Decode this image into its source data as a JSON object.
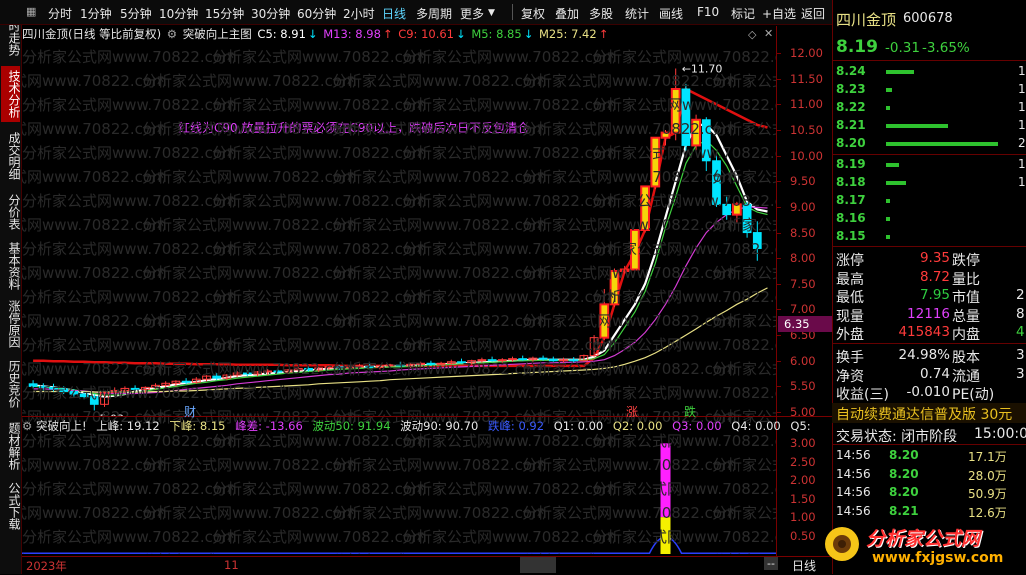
{
  "toolbar": {
    "periods": [
      "分时",
      "1分钟",
      "5分钟",
      "10分钟",
      "15分钟",
      "30分钟",
      "60分钟",
      "2小时",
      "日线",
      "多周期",
      "更多"
    ],
    "active_period": "日线",
    "actions": [
      "复权",
      "叠加",
      "多股",
      "统计",
      "画线",
      "F10",
      "标记",
      "+自选",
      "返回"
    ]
  },
  "left_tabs": [
    "分时走势",
    "技术分析",
    "成交明细",
    "分价表",
    "基本资料",
    "涨停原因",
    "历史竞价",
    "题材解析",
    "公式下载"
  ],
  "chart_header": {
    "title": "四川金顶(日线 等比前复权)",
    "formula": "突破向上主图",
    "c5": "C5: 8.91",
    "m13": "M13: 8.98",
    "c9": "C9: 10.61",
    "m5": "M5: 8.85",
    "m25": "M25: 7.42"
  },
  "annotation": "红线为C90,放量拉升的票必须在C90以上，跌破后次日不反包清仓",
  "watermark": "分析家公式网www.70822.com",
  "price_axis": [
    "12.00",
    "11.50",
    "11.00",
    "10.50",
    "10.00",
    "9.50",
    "9.00",
    "8.50",
    "8.00",
    "7.50",
    "7.00",
    "6.50",
    "6.00",
    "5.50",
    "5.00"
  ],
  "current_price_tag": "6.35",
  "high_label": "11.70",
  "low_label": "5.03",
  "markers": {
    "cai": "财",
    "zhang": "涨",
    "die": "跌"
  },
  "indicator_header": {
    "name": "突破向上!",
    "shang_feng": "上峰: 19.12",
    "xia_feng": "下峰: 8.15",
    "feng_cha": "峰差: -13.66",
    "bo50": "波动50: 91.94",
    "bo90": "波动90: 90.70",
    "die_feng": "跌峰: 0.92",
    "q1": "Q1: 0.00",
    "q2": "Q2: 0.00",
    "q3": "Q3: 0.00",
    "q4": "Q4: 0.00",
    "q5": "Q5:"
  },
  "indicator_axis": [
    "3.00",
    "2.50",
    "2.00",
    "1.50",
    "1.00",
    "0.50"
  ],
  "date_axis": {
    "y2023": "2023年",
    "m11": "11",
    "m12": "12",
    "period": "日线",
    "dash": "--"
  },
  "stock": {
    "name": "四川金顶",
    "code": "600678",
    "price": "8.19",
    "change": "-0.31",
    "pct": "-3.65%"
  },
  "order_book": [
    {
      "price": "8.24",
      "vol": "1",
      "bar": 0.25
    },
    {
      "price": "8.23",
      "vol": "1",
      "bar": 0.05
    },
    {
      "price": "8.22",
      "vol": "1",
      "bar": 0.04
    },
    {
      "price": "8.21",
      "vol": "10",
      "bar": 0.55
    },
    {
      "price": "8.20",
      "vol": "20",
      "bar": 1.0
    },
    {
      "price": "8.19",
      "vol": "1",
      "bar": 0.12
    },
    {
      "price": "8.18",
      "vol": "1",
      "bar": 0.18
    },
    {
      "price": "8.17",
      "vol": "",
      "bar": 0.03
    },
    {
      "price": "8.16",
      "vol": "",
      "bar": 0.03
    },
    {
      "price": "8.15",
      "vol": "",
      "bar": 0.03
    }
  ],
  "quote": [
    {
      "l": "涨停",
      "v": "9.35",
      "c": "#ff3b3b",
      "l2": "跌停",
      "v2": ""
    },
    {
      "l": "最高",
      "v": "8.72",
      "c": "#ff3b3b",
      "l2": "量比",
      "v2": ""
    },
    {
      "l": "最低",
      "v": "7.95",
      "c": "#2ecc40",
      "l2": "市值",
      "v2": "2"
    },
    {
      "l": "现量",
      "v": "12116",
      "c": "#e040fb",
      "l2": "总量",
      "v2": "8"
    },
    {
      "l": "外盘",
      "v": "415843",
      "c": "#ff3b3b",
      "l2": "内盘",
      "v2": "4"
    },
    {
      "l": "换手",
      "v": "24.98%",
      "c": "#e8e8e8",
      "l2": "股本",
      "v2": "3"
    },
    {
      "l": "净资",
      "v": "0.74",
      "c": "#e8e8e8",
      "l2": "流通",
      "v2": "3"
    },
    {
      "l": "收益(三)",
      "v": "-0.010",
      "c": "#e8e8e8",
      "l2": "PE(动)",
      "v2": ""
    }
  ],
  "promo": "自动续费通达信普及版 30元",
  "trade_status": {
    "label": "交易状态: 闭市阶段",
    "time": "15:00:02"
  },
  "ticks": [
    {
      "t": "14:56",
      "p": "8.20",
      "v": "17.1万"
    },
    {
      "t": "14:56",
      "p": "8.20",
      "v": "28.0万"
    },
    {
      "t": "14:56",
      "p": "8.20",
      "v": "50.9万"
    },
    {
      "t": "14:56",
      "p": "8.21",
      "v": "12.6万"
    }
  ],
  "logo": {
    "cn": "分析家公式网",
    "url": "www.fxjgsw.com"
  },
  "colors": {
    "up": "#ff3b3b",
    "down": "#00e5ff",
    "c90": "#e01010",
    "ma_white": "#ffffff",
    "ma_green": "#3ed13e",
    "ma_magenta": "#d33bd3",
    "ma_yellow": "#e8e085"
  },
  "chart_data": {
    "type": "candlestick",
    "price_range": [
      5.0,
      12.1
    ],
    "candles": [
      {
        "o": 5.55,
        "h": 5.62,
        "l": 5.45,
        "c": 5.5
      },
      {
        "o": 5.5,
        "h": 5.56,
        "l": 5.42,
        "c": 5.48
      },
      {
        "o": 5.48,
        "h": 5.55,
        "l": 5.4,
        "c": 5.45
      },
      {
        "o": 5.45,
        "h": 5.5,
        "l": 5.35,
        "c": 5.4
      },
      {
        "o": 5.4,
        "h": 5.45,
        "l": 5.3,
        "c": 5.35
      },
      {
        "o": 5.35,
        "h": 5.4,
        "l": 5.25,
        "c": 5.3
      },
      {
        "o": 5.3,
        "h": 5.35,
        "l": 5.03,
        "c": 5.15
      },
      {
        "o": 5.15,
        "h": 5.4,
        "l": 5.1,
        "c": 5.38
      },
      {
        "o": 5.38,
        "h": 5.48,
        "l": 5.33,
        "c": 5.42
      },
      {
        "o": 5.42,
        "h": 5.5,
        "l": 5.38,
        "c": 5.46
      },
      {
        "o": 5.46,
        "h": 5.52,
        "l": 5.4,
        "c": 5.44
      },
      {
        "o": 5.44,
        "h": 5.5,
        "l": 5.38,
        "c": 5.48
      },
      {
        "o": 5.48,
        "h": 5.56,
        "l": 5.44,
        "c": 5.52
      },
      {
        "o": 5.52,
        "h": 5.6,
        "l": 5.48,
        "c": 5.56
      },
      {
        "o": 5.56,
        "h": 5.62,
        "l": 5.5,
        "c": 5.6
      },
      {
        "o": 5.6,
        "h": 5.66,
        "l": 5.54,
        "c": 5.58
      },
      {
        "o": 5.58,
        "h": 5.68,
        "l": 5.55,
        "c": 5.64
      },
      {
        "o": 5.64,
        "h": 5.72,
        "l": 5.6,
        "c": 5.7
      },
      {
        "o": 5.7,
        "h": 5.76,
        "l": 5.62,
        "c": 5.66
      },
      {
        "o": 5.66,
        "h": 5.74,
        "l": 5.62,
        "c": 5.72
      },
      {
        "o": 5.72,
        "h": 5.8,
        "l": 5.68,
        "c": 5.76
      },
      {
        "o": 5.76,
        "h": 5.82,
        "l": 5.7,
        "c": 5.74
      },
      {
        "o": 5.74,
        "h": 5.8,
        "l": 5.7,
        "c": 5.78
      },
      {
        "o": 5.78,
        "h": 5.84,
        "l": 5.72,
        "c": 5.8
      },
      {
        "o": 5.8,
        "h": 5.86,
        "l": 5.75,
        "c": 5.78
      },
      {
        "o": 5.78,
        "h": 5.84,
        "l": 5.74,
        "c": 5.82
      },
      {
        "o": 5.82,
        "h": 5.88,
        "l": 5.78,
        "c": 5.85
      },
      {
        "o": 5.85,
        "h": 5.9,
        "l": 5.79,
        "c": 5.82
      },
      {
        "o": 5.82,
        "h": 5.88,
        "l": 5.78,
        "c": 5.86
      },
      {
        "o": 5.86,
        "h": 5.92,
        "l": 5.82,
        "c": 5.88
      },
      {
        "o": 5.88,
        "h": 5.92,
        "l": 5.82,
        "c": 5.86
      },
      {
        "o": 5.86,
        "h": 5.9,
        "l": 5.82,
        "c": 5.88
      },
      {
        "o": 5.88,
        "h": 5.94,
        "l": 5.84,
        "c": 5.9
      },
      {
        "o": 5.9,
        "h": 5.96,
        "l": 5.85,
        "c": 5.87
      },
      {
        "o": 5.87,
        "h": 5.92,
        "l": 5.83,
        "c": 5.9
      },
      {
        "o": 5.9,
        "h": 5.94,
        "l": 5.86,
        "c": 5.92
      },
      {
        "o": 5.92,
        "h": 5.98,
        "l": 5.88,
        "c": 5.9
      },
      {
        "o": 5.9,
        "h": 5.96,
        "l": 5.86,
        "c": 5.93
      },
      {
        "o": 5.93,
        "h": 5.98,
        "l": 5.88,
        "c": 5.95
      },
      {
        "o": 5.95,
        "h": 6.0,
        "l": 5.9,
        "c": 5.93
      },
      {
        "o": 5.93,
        "h": 5.98,
        "l": 5.9,
        "c": 5.95
      },
      {
        "o": 5.95,
        "h": 6.02,
        "l": 5.92,
        "c": 5.98
      },
      {
        "o": 5.98,
        "h": 6.04,
        "l": 5.94,
        "c": 5.96
      },
      {
        "o": 5.96,
        "h": 6.02,
        "l": 5.92,
        "c": 6.0
      },
      {
        "o": 6.0,
        "h": 6.06,
        "l": 5.96,
        "c": 6.02
      },
      {
        "o": 6.02,
        "h": 6.08,
        "l": 5.98,
        "c": 6.0
      },
      {
        "o": 6.0,
        "h": 6.05,
        "l": 5.96,
        "c": 6.02
      },
      {
        "o": 6.02,
        "h": 6.08,
        "l": 5.98,
        "c": 6.04
      },
      {
        "o": 6.04,
        "h": 6.1,
        "l": 6.0,
        "c": 6.02
      },
      {
        "o": 6.02,
        "h": 6.08,
        "l": 5.98,
        "c": 6.05
      },
      {
        "o": 6.05,
        "h": 6.1,
        "l": 6.0,
        "c": 6.03
      },
      {
        "o": 6.03,
        "h": 6.08,
        "l": 5.98,
        "c": 6.0
      },
      {
        "o": 6.0,
        "h": 6.06,
        "l": 5.96,
        "c": 6.02
      },
      {
        "o": 6.02,
        "h": 6.07,
        "l": 5.97,
        "c": 6.0
      },
      {
        "o": 6.0,
        "h": 6.12,
        "l": 5.98,
        "c": 6.1
      },
      {
        "o": 6.1,
        "h": 6.5,
        "l": 6.08,
        "c": 6.45
      },
      {
        "o": 6.45,
        "h": 7.4,
        "l": 6.4,
        "c": 7.1
      },
      {
        "o": 7.1,
        "h": 7.8,
        "l": 7.05,
        "c": 7.75
      },
      {
        "o": 7.75,
        "h": 7.85,
        "l": 7.7,
        "c": 7.78
      },
      {
        "o": 7.78,
        "h": 8.55,
        "l": 7.75,
        "c": 8.55
      },
      {
        "o": 8.55,
        "h": 9.4,
        "l": 8.5,
        "c": 9.4
      },
      {
        "o": 9.4,
        "h": 10.35,
        "l": 9.35,
        "c": 10.35
      },
      {
        "o": 10.35,
        "h": 10.5,
        "l": 10.2,
        "c": 10.45
      },
      {
        "o": 10.45,
        "h": 11.7,
        "l": 10.3,
        "c": 11.3
      },
      {
        "o": 11.3,
        "h": 11.4,
        "l": 10.1,
        "c": 10.2
      },
      {
        "o": 10.2,
        "h": 10.8,
        "l": 10.1,
        "c": 10.7
      },
      {
        "o": 10.7,
        "h": 10.75,
        "l": 9.7,
        "c": 9.9
      },
      {
        "o": 9.9,
        "h": 10.0,
        "l": 9.0,
        "c": 9.05
      },
      {
        "o": 9.05,
        "h": 9.2,
        "l": 8.75,
        "c": 8.85
      },
      {
        "o": 8.85,
        "h": 9.1,
        "l": 8.7,
        "c": 9.05
      },
      {
        "o": 9.05,
        "h": 9.1,
        "l": 8.4,
        "c": 8.5
      },
      {
        "o": 8.5,
        "h": 8.72,
        "l": 7.95,
        "c": 8.19
      }
    ],
    "series": [
      {
        "name": "C90",
        "values": [
          6.0,
          6.0,
          5.99,
          5.99,
          5.98,
          5.98,
          5.97,
          5.97,
          5.96,
          5.96,
          5.95,
          5.95,
          5.95,
          5.94,
          5.94,
          5.94,
          5.93,
          5.93,
          5.93,
          5.93,
          5.92,
          5.92,
          5.92,
          5.92,
          5.92,
          5.91,
          5.91,
          5.91,
          5.91,
          5.91,
          5.9,
          5.9,
          5.9,
          5.9,
          5.9,
          5.9,
          5.9,
          5.9,
          5.9,
          5.9,
          5.9,
          5.9,
          5.9,
          5.9,
          5.9,
          5.9,
          5.9,
          5.9,
          5.9,
          5.9,
          5.9,
          5.9,
          5.9,
          5.9,
          5.9,
          6.05,
          6.45,
          7.1,
          7.75,
          8.1,
          8.55,
          9.4,
          10.35,
          10.45,
          11.3,
          11.2,
          11.1,
          11.0,
          10.9,
          10.8,
          10.7,
          10.6,
          10.55
        ]
      },
      {
        "name": "C5",
        "values": [
          5.52,
          5.5,
          5.48,
          5.45,
          5.42,
          5.38,
          5.33,
          5.3,
          5.32,
          5.35,
          5.4,
          5.44,
          5.47,
          5.5,
          5.54,
          5.57,
          5.59,
          5.62,
          5.64,
          5.67,
          5.7,
          5.72,
          5.73,
          5.75,
          5.76,
          5.78,
          5.8,
          5.81,
          5.83,
          5.84,
          5.85,
          5.86,
          5.87,
          5.88,
          5.88,
          5.89,
          5.9,
          5.9,
          5.91,
          5.92,
          5.93,
          5.94,
          5.95,
          5.96,
          5.97,
          5.98,
          5.99,
          6.0,
          6.01,
          6.02,
          6.02,
          6.02,
          6.02,
          6.02,
          6.02,
          6.08,
          6.2,
          6.5,
          6.8,
          7.1,
          7.5,
          8.1,
          8.8,
          9.5,
          10.2,
          10.6,
          10.6,
          10.4,
          10.0,
          9.6,
          9.1,
          8.95,
          8.91
        ]
      },
      {
        "name": "M5",
        "values": [
          5.5,
          5.49,
          5.47,
          5.45,
          5.43,
          5.4,
          5.36,
          5.33,
          5.33,
          5.35,
          5.38,
          5.41,
          5.44,
          5.47,
          5.5,
          5.53,
          5.56,
          5.58,
          5.61,
          5.63,
          5.66,
          5.68,
          5.7,
          5.72,
          5.74,
          5.76,
          5.77,
          5.79,
          5.8,
          5.82,
          5.83,
          5.84,
          5.85,
          5.86,
          5.87,
          5.88,
          5.88,
          5.89,
          5.9,
          5.91,
          5.92,
          5.93,
          5.94,
          5.95,
          5.96,
          5.97,
          5.98,
          5.99,
          6.0,
          6.0,
          6.01,
          6.01,
          6.01,
          6.01,
          6.01,
          6.04,
          6.12,
          6.35,
          6.65,
          6.95,
          7.35,
          7.9,
          8.6,
          9.2,
          9.85,
          10.2,
          10.3,
          10.1,
          9.8,
          9.4,
          9.0,
          8.9,
          8.85
        ]
      },
      {
        "name": "M13",
        "values": [
          5.45,
          5.45,
          5.44,
          5.43,
          5.42,
          5.41,
          5.39,
          5.37,
          5.36,
          5.36,
          5.36,
          5.37,
          5.38,
          5.4,
          5.42,
          5.44,
          5.46,
          5.48,
          5.5,
          5.52,
          5.55,
          5.57,
          5.59,
          5.61,
          5.63,
          5.65,
          5.67,
          5.69,
          5.71,
          5.73,
          5.74,
          5.76,
          5.77,
          5.78,
          5.79,
          5.8,
          5.82,
          5.83,
          5.84,
          5.85,
          5.86,
          5.87,
          5.88,
          5.89,
          5.9,
          5.91,
          5.92,
          5.93,
          5.94,
          5.95,
          5.96,
          5.96,
          5.97,
          5.97,
          5.98,
          5.99,
          6.02,
          6.1,
          6.22,
          6.36,
          6.55,
          6.8,
          7.1,
          7.45,
          7.85,
          8.2,
          8.5,
          8.7,
          8.85,
          8.95,
          9.0,
          8.99,
          8.98
        ]
      },
      {
        "name": "M25",
        "values": [
          5.4,
          5.4,
          5.4,
          5.4,
          5.4,
          5.4,
          5.39,
          5.39,
          5.39,
          5.39,
          5.39,
          5.39,
          5.4,
          5.4,
          5.41,
          5.41,
          5.42,
          5.43,
          5.44,
          5.45,
          5.46,
          5.47,
          5.48,
          5.49,
          5.5,
          5.51,
          5.52,
          5.53,
          5.55,
          5.56,
          5.57,
          5.58,
          5.59,
          5.6,
          5.61,
          5.63,
          5.64,
          5.65,
          5.66,
          5.67,
          5.68,
          5.69,
          5.7,
          5.71,
          5.72,
          5.73,
          5.74,
          5.75,
          5.76,
          5.77,
          5.78,
          5.79,
          5.8,
          5.81,
          5.82,
          5.83,
          5.85,
          5.88,
          5.93,
          5.99,
          6.06,
          6.15,
          6.26,
          6.38,
          6.5,
          6.62,
          6.75,
          6.87,
          6.98,
          7.1,
          7.2,
          7.32,
          7.42
        ]
      },
      {
        "name": "波动",
        "values": [
          0,
          0,
          0,
          0,
          0,
          0,
          0,
          0,
          0,
          0,
          0,
          0,
          0,
          0,
          0,
          0,
          0,
          0,
          0,
          0,
          0,
          0,
          0,
          0,
          0,
          0,
          0,
          0,
          0,
          0,
          0,
          0,
          0,
          0,
          0,
          0,
          0,
          0,
          0,
          0,
          0,
          0,
          0,
          0,
          0,
          0,
          0,
          0,
          0,
          0,
          0,
          0,
          0,
          0,
          0,
          0,
          0,
          0,
          0,
          0,
          0,
          0,
          0,
          0,
          0,
          0,
          0,
          0,
          0,
          0,
          0,
          0,
          0
        ]
      }
    ],
    "indicator_spike": {
      "index": 62,
      "magenta": 3.0,
      "yellow": 1.0
    },
    "indicator_range": [
      0,
      3.2
    ]
  }
}
